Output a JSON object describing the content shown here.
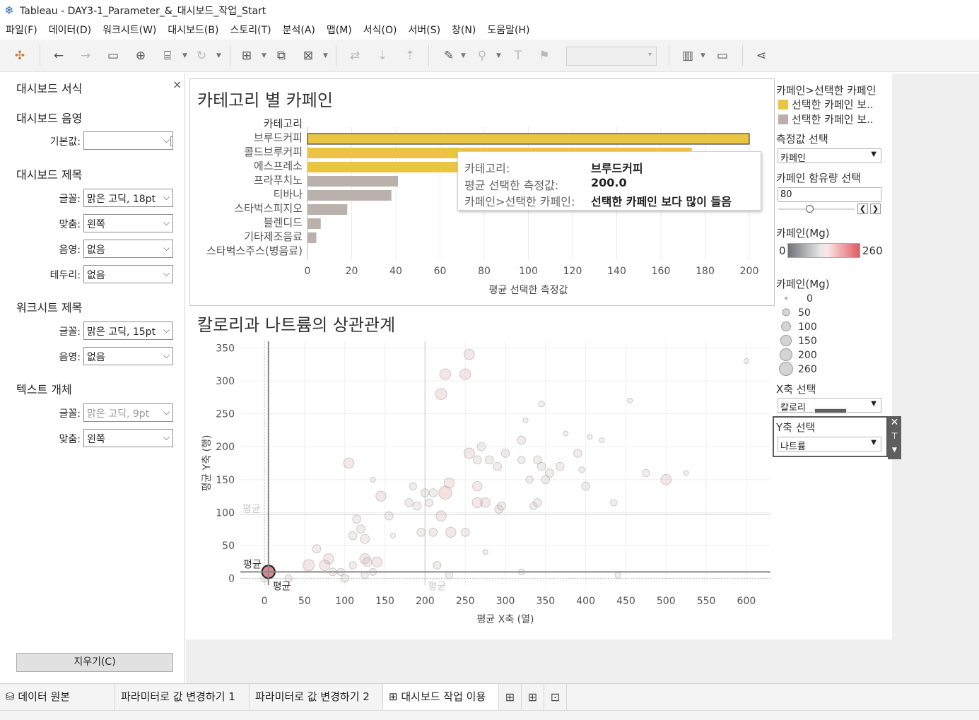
{
  "window": {
    "title": "Tableau - DAY3-1_Parameter_&_대시보드_작업_Start"
  },
  "menu": [
    "파일(F)",
    "데이터(D)",
    "워크시트(W)",
    "대시보드(B)",
    "스토리(T)",
    "분석(A)",
    "맵(M)",
    "서식(O)",
    "서버(S)",
    "창(N)",
    "도움말(H)"
  ],
  "left_panel": {
    "title": "대시보드 서식",
    "close": "×",
    "shading_section": "대시보드 음영",
    "default_label": "기본값:",
    "title_section": "대시보드 제목",
    "font_label": "글꼴:",
    "title_font": "맑은 고딕, 18pt",
    "align_label": "맞춤:",
    "title_align": "왼쪽",
    "shade_label": "음영:",
    "title_shade": "없음",
    "border_label": "테두리:",
    "title_border": "없음",
    "ws_section": "워크시트 제목",
    "ws_font": "맑은 고딕, 15pt",
    "ws_shade": "없음",
    "text_section": "텍스트 개체",
    "text_font": "맑은 고딕, 9pt",
    "text_align": "왼쪽",
    "clear_button": "지우기(C)"
  },
  "sheet1": {
    "title": "카테고리 별 카페인",
    "row_header": "카테고리"
  },
  "sheet2": {
    "title": "칼로리과 나트륨의 상관관계"
  },
  "tooltip": {
    "k1": "카테고리:",
    "v1": "브루드커피",
    "k2": "평균 선택한 측정값:",
    "v2": "200.0",
    "k3": "카페인>선택한 카페인:",
    "v3": "선택한 카페인 보다 많이 들음"
  },
  "chart_data": [
    {
      "type": "bar",
      "title": "카테고리 별 카페인",
      "xlabel": "평균 선택한 측정값",
      "ylabel": "카테고리",
      "xlim": [
        0,
        200
      ],
      "xticks": [
        0,
        20,
        40,
        60,
        80,
        100,
        120,
        140,
        160,
        180,
        200
      ],
      "categories": [
        "브루드커피",
        "콜드브루커피",
        "에스프레소",
        "프라푸치노",
        "티바나",
        "스타벅스피지오",
        "블렌디드",
        "기타제조음료",
        "스타벅스주스(병음료)"
      ],
      "values": [
        200,
        174,
        110,
        41,
        38,
        18,
        6,
        4,
        0
      ],
      "color_group": [
        "선택한 카페인 보다 많이 들음",
        "선택한 카페인 보다 많이 들음",
        "선택한 카페인 보다 많이 들음",
        "선택한 카페인 보다 적게 들음",
        "선택한 카페인 보다 적게 들음",
        "선택한 카페인 보다 적게 들음",
        "선택한 카페인 보다 적게 들음",
        "선택한 카페인 보다 적게 들음",
        "선택한 카페인 보다 적게 들음"
      ],
      "colors": {
        "high": "#EAC442",
        "low": "#BAB0AC"
      }
    },
    {
      "type": "scatter",
      "title": "칼로리과 나트륨의 상관관계",
      "xlabel": "평균 X축 (열)",
      "ylabel": "평균 Y축 (행)",
      "xlim": [
        -30,
        630
      ],
      "ylim": [
        -10,
        360
      ],
      "xticks": [
        0,
        50,
        100,
        150,
        200,
        250,
        300,
        350,
        400,
        450,
        500,
        550,
        600
      ],
      "yticks": [
        0,
        50,
        100,
        150,
        200,
        250,
        300,
        350
      ],
      "ref_label": "평균",
      "points": [
        [
          5,
          10,
          260
        ],
        [
          0,
          0,
          40
        ],
        [
          30,
          0,
          40
        ],
        [
          55,
          20,
          150
        ],
        [
          75,
          20,
          120
        ],
        [
          80,
          30,
          110
        ],
        [
          65,
          45,
          60
        ],
        [
          85,
          10,
          50
        ],
        [
          95,
          10,
          40
        ],
        [
          100,
          0,
          50
        ],
        [
          110,
          20,
          40
        ],
        [
          105,
          175,
          120
        ],
        [
          115,
          90,
          60
        ],
        [
          110,
          65,
          60
        ],
        [
          120,
          75,
          60
        ],
        [
          125,
          60,
          80
        ],
        [
          125,
          30,
          110
        ],
        [
          128,
          25,
          80
        ],
        [
          140,
          25,
          110
        ],
        [
          135,
          10,
          40
        ],
        [
          125,
          5,
          40
        ],
        [
          145,
          125,
          110
        ],
        [
          155,
          95,
          60
        ],
        [
          160,
          65,
          10
        ],
        [
          180,
          115,
          60
        ],
        [
          185,
          140,
          40
        ],
        [
          190,
          110,
          60
        ],
        [
          195,
          70,
          60
        ],
        [
          200,
          130,
          60
        ],
        [
          205,
          115,
          50
        ],
        [
          210,
          70,
          60
        ],
        [
          210,
          130,
          60
        ],
        [
          215,
          20,
          50
        ],
        [
          220,
          280,
          140
        ],
        [
          225,
          310,
          130
        ],
        [
          220,
          95,
          110
        ],
        [
          225,
          130,
          210
        ],
        [
          230,
          145,
          110
        ],
        [
          232,
          70,
          110
        ],
        [
          230,
          5,
          40
        ],
        [
          250,
          310,
          130
        ],
        [
          255,
          340,
          120
        ],
        [
          250,
          70,
          60
        ],
        [
          255,
          190,
          120
        ],
        [
          265,
          180,
          60
        ],
        [
          265,
          140,
          90
        ],
        [
          265,
          115,
          110
        ],
        [
          270,
          200,
          60
        ],
        [
          275,
          40,
          10
        ],
        [
          275,
          115,
          90
        ],
        [
          280,
          180,
          60
        ],
        [
          290,
          170,
          60
        ],
        [
          292,
          105,
          60
        ],
        [
          295,
          110,
          60
        ],
        [
          300,
          190,
          60
        ],
        [
          320,
          210,
          60
        ],
        [
          320,
          180,
          40
        ],
        [
          325,
          240,
          10
        ],
        [
          330,
          150,
          40
        ],
        [
          335,
          110,
          40
        ],
        [
          340,
          115,
          60
        ],
        [
          340,
          180,
          60
        ],
        [
          345,
          265,
          20
        ],
        [
          345,
          170,
          60
        ],
        [
          350,
          150,
          60
        ],
        [
          355,
          160,
          60
        ],
        [
          368,
          170,
          60
        ],
        [
          375,
          220,
          10
        ],
        [
          390,
          190,
          60
        ],
        [
          395,
          165,
          20
        ],
        [
          400,
          140,
          60
        ],
        [
          405,
          215,
          10
        ],
        [
          420,
          210,
          10
        ],
        [
          435,
          115,
          30
        ],
        [
          440,
          5,
          20
        ],
        [
          455,
          270,
          10
        ],
        [
          475,
          160,
          40
        ],
        [
          500,
          150,
          120
        ],
        [
          525,
          160,
          10
        ],
        [
          600,
          330,
          10
        ],
        [
          320,
          10,
          20
        ],
        [
          135,
          150,
          10
        ]
      ]
    }
  ],
  "legend": {
    "color_title": "카페인>선택한 카페인",
    "color_items": [
      {
        "label": "선택한 카페인 보..",
        "color": "#EAC442"
      },
      {
        "label": "선택한 카페인 보..",
        "color": "#BAB0AC"
      }
    ],
    "measure_title": "측정값 선택",
    "measure_value": "카페인",
    "caffeine_param_title": "카페인 함유량 선택",
    "caffeine_param_value": "80",
    "gradient_title": "카페인(Mg)",
    "gradient_min": "0",
    "gradient_max": "260",
    "size_title": "카페인(Mg)",
    "size_items": [
      "0",
      "50",
      "100",
      "150",
      "200",
      "260"
    ],
    "x_title": "X축 선택",
    "x_value": "칼로리",
    "y_title": "Y축 선택",
    "y_value": "나트륨"
  },
  "tabs": {
    "datasource": "데이터 원본",
    "tab1": "파라미터로 값 변경하기 1",
    "tab2": "파라미터로 값 변경하기 2",
    "tab3": "대시보드 작업 이용"
  }
}
